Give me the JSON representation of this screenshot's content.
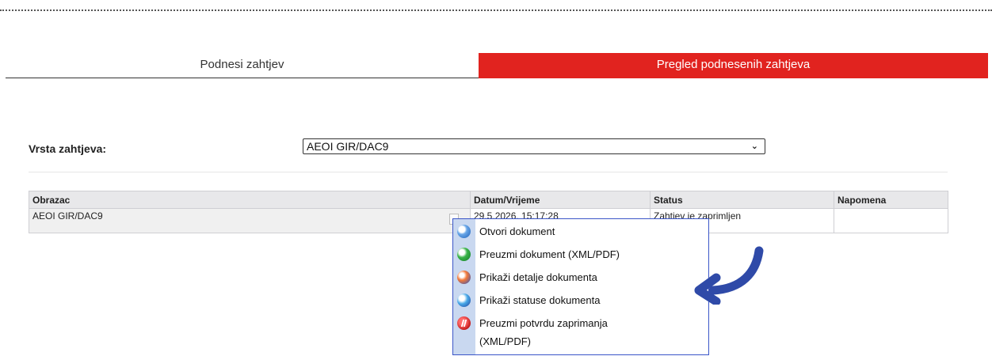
{
  "tabs": {
    "submit_label": "Podnesi zahtjev",
    "review_label": "Pregled podnesenih zahtjeva"
  },
  "filter": {
    "label": "Vrsta zahtjeva:",
    "selected": "AEOI GIR/DAC9"
  },
  "table": {
    "headers": [
      "Obrazac",
      "Datum/Vrijeme",
      "Status",
      "Napomena"
    ],
    "rows": [
      {
        "form": "AEOI GIR/DAC9",
        "datetime": "29.5.2026. 15:17:28",
        "status": "Zahtjev je zaprimljen",
        "note": ""
      }
    ]
  },
  "context_menu": {
    "items": [
      {
        "label": "Otvori dokument",
        "icon": "open-document-icon"
      },
      {
        "label": "Preuzmi dokument (XML/PDF)",
        "icon": "download-document-icon"
      },
      {
        "label": "Prikaži detalje dokumenta",
        "icon": "document-details-icon"
      },
      {
        "label": "Prikaži statuse dokumenta",
        "icon": "document-statuses-icon"
      },
      {
        "label_line1": "Preuzmi potvrdu zaprimanja",
        "label_line2": "(XML/PDF)",
        "icon": "receipt-confirmation-icon"
      }
    ]
  },
  "colors": {
    "active_tab": "#e1231f",
    "menu_border": "#3b56c8",
    "menu_gutter": "#c9d8f0",
    "annotation_arrow": "#2f4aa8"
  }
}
